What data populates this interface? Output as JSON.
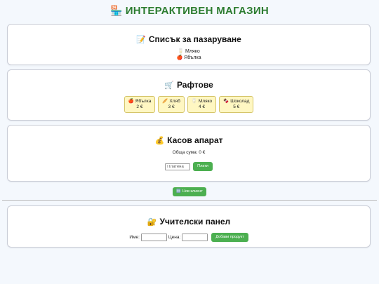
{
  "app": {
    "title": "ИНТЕРАКТИВЕН МАГАЗИН",
    "title_icon": "🏪"
  },
  "shopping_list": {
    "title": "Списък за пазаруване",
    "title_icon": "📝",
    "items": [
      {
        "icon": "🥛",
        "label": "Мляко"
      },
      {
        "icon": "🍎",
        "label": "Ябълка"
      }
    ]
  },
  "shelves": {
    "title": "Рафтове",
    "title_icon": "🛒",
    "products": [
      {
        "icon": "🍎",
        "name": "Ябълка",
        "price": "2 €"
      },
      {
        "icon": "🥖",
        "name": "Хляб",
        "price": "3 €"
      },
      {
        "icon": "🥛",
        "name": "Мляко",
        "price": "4 €"
      },
      {
        "icon": "🍫",
        "name": "Шоколад",
        "price": "5 €"
      }
    ]
  },
  "register": {
    "title": "Касов апарат",
    "title_icon": "💰",
    "total_label": "Обща сума: 0 €",
    "paid_placeholder": "Платена",
    "pay_button": "Плати"
  },
  "new_client": {
    "icon": "🆕",
    "label": "Нов клиент"
  },
  "teacher_panel": {
    "title": "Учителски панел",
    "title_icon": "🔐",
    "name_label": "Име:",
    "price_label": "Цена:",
    "add_button": "Добави продукт"
  },
  "colors": {
    "title_green": "#2e7d32",
    "button_green": "#4caf50",
    "product_bg": "#fff7c2",
    "page_bg": "#f4f8fd"
  }
}
